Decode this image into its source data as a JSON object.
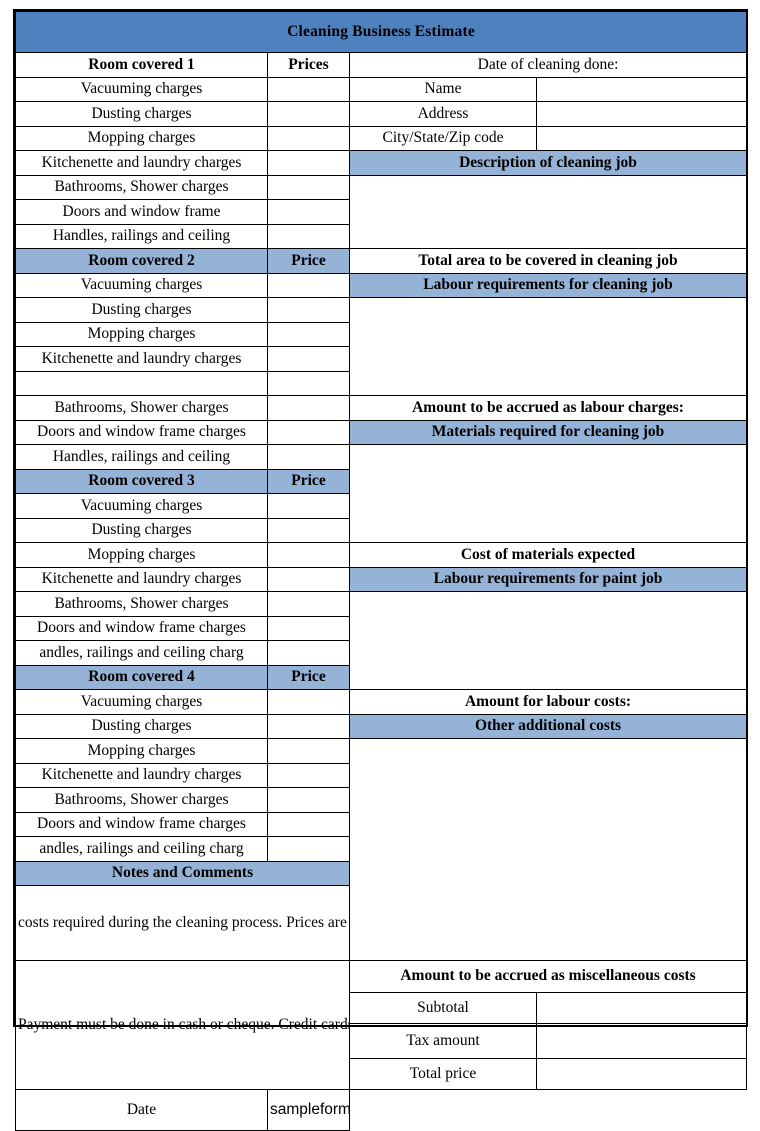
{
  "document": {
    "title": "Cleaning Business Estimate",
    "watermark": "sampleforms.org"
  },
  "colors": {
    "title_blue": "#4e81bd",
    "header_blue": "#95b3d7",
    "watermark": "#7e9ab5",
    "border": "#000000"
  },
  "left_column": {
    "rooms": [
      {
        "header": "Room covered 1",
        "price_header": "Prices",
        "items": [
          "Vacuuming charges",
          "Dusting charges",
          "Mopping charges",
          "Kitchenette and laundry charges",
          "Bathrooms, Shower charges",
          "Doors and window frame",
          "Handles, railings and ceiling"
        ]
      },
      {
        "header": "Room covered 2",
        "price_header": "Price",
        "items": [
          "Vacuuming charges",
          "Dusting charges",
          "Mopping charges",
          "Kitchenette and laundry charges",
          "Bathrooms, Shower charges",
          "Doors and window frame charges",
          "Handles, railings and ceiling"
        ]
      },
      {
        "header": "Room covered 3",
        "price_header": "Price",
        "items": [
          "Vacuuming charges",
          "Dusting charges",
          "Mopping charges",
          "Kitchenette and laundry charges",
          "Bathrooms, Shower charges",
          "Doors and window frame charges",
          "andles, railings and ceiling charg"
        ]
      },
      {
        "header": "Room covered 4",
        "price_header": "Price",
        "items": [
          "Vacuuming charges",
          "Dusting charges",
          "Mopping charges",
          "Kitchenette and laundry charges",
          "Bathrooms, Shower charges",
          "Doors and window frame charges",
          "andles, railings and ceiling charg"
        ]
      }
    ],
    "notes": {
      "header": "Notes and Comments",
      "paragraph_1": "costs required during the cleaning process. Prices are based on current material costs and labour charges. These are subject to",
      "paragraph_2": "Payment must be done in cash or cheque. Credit cards are accepted as well [only VISA or MasterCard. Boucing of cheques is a criminal offence."
    }
  },
  "right_column": {
    "date_of_cleaning_label": "Date of cleaning done:",
    "date_of_cleaning_value": "",
    "contact_fields": [
      {
        "label": "Name",
        "value": ""
      },
      {
        "label": "Address",
        "value": ""
      },
      {
        "label": "City/State/Zip code",
        "value": ""
      }
    ],
    "sections": [
      {
        "header": "Description of cleaning job",
        "body": "",
        "footer": "Total area to be covered in cleaning job"
      },
      {
        "header": "Labour requirements for cleaning job",
        "body": "",
        "footer": "Amount to be accrued as labour charges:"
      },
      {
        "header": "Materials required for cleaning job",
        "body": "",
        "footer": "Cost of materials expected"
      },
      {
        "header": "Labour requirements for paint job",
        "body": "",
        "footer": "Amount for labour costs:"
      },
      {
        "header": "Other additional costs",
        "body": "",
        "footer": "Amount to be accrued as miscellaneous costs"
      }
    ],
    "totals": [
      {
        "label": "Subtotal",
        "value": ""
      },
      {
        "label": "Tax amount",
        "value": ""
      },
      {
        "label": "Total price",
        "value": ""
      },
      {
        "label": "Date",
        "value": ""
      }
    ]
  }
}
